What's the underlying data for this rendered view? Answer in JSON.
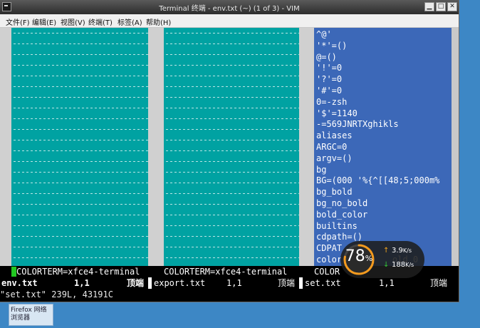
{
  "window": {
    "title": "Terminal 终端 - env.txt (~) (1 of 3) - VIM"
  },
  "menubar": {
    "items": [
      "文件(F)",
      "编辑(E)",
      "视图(V)",
      "终端(T)",
      "标签(A)",
      "帮助(H)"
    ]
  },
  "vim": {
    "panes": [
      {
        "bottom_line": "COLORTERM=xfce4-terminal",
        "file": "env.txt",
        "pos": "1,1",
        "scroll": "顶端"
      },
      {
        "bottom_line": "COLORTERM=xfce4-terminal",
        "file": "export.txt",
        "pos": "1,1",
        "scroll": "顶端"
      },
      {
        "bottom_line": "COLOR",
        "file": "set.txt",
        "pos": "1,1",
        "scroll": "顶端"
      }
    ],
    "right_lines": [
      "^@'",
      "'*'=()",
      "@=()",
      "'!'=0",
      "'?'=0",
      "'#'=0",
      "0=-zsh",
      "'$'=1140",
      "-=569JNRTXghikls",
      "aliases",
      "ARGC=0",
      "argv=()",
      "bg",
      "BG=(000 '%{^[[48;5;000m%",
      "bg_bold",
      "bg_no_bold",
      "bold_color",
      "builtins",
      "cdpath=()",
      "CDPAT",
      "color",
      "old 0"
    ],
    "command_line": "\"set.txt\" 239L, 43191C"
  },
  "net_widget": {
    "percent": "78",
    "percent_unit": "%",
    "up_rate": "3.9",
    "up_unit": "K/s",
    "down_rate": "188",
    "down_unit": "K/s",
    "level": 0.78,
    "colors": {
      "ring_fg": "#f39a1e",
      "up_arrow": "#f3a51e",
      "down_arrow": "#33c733"
    }
  },
  "taskbar": {
    "firefox_label": "Firefox 网络浏览器"
  },
  "colors": {
    "teal": "#00a2a2",
    "blue_pane": "#3c68b8",
    "cursor": "#21c721"
  }
}
